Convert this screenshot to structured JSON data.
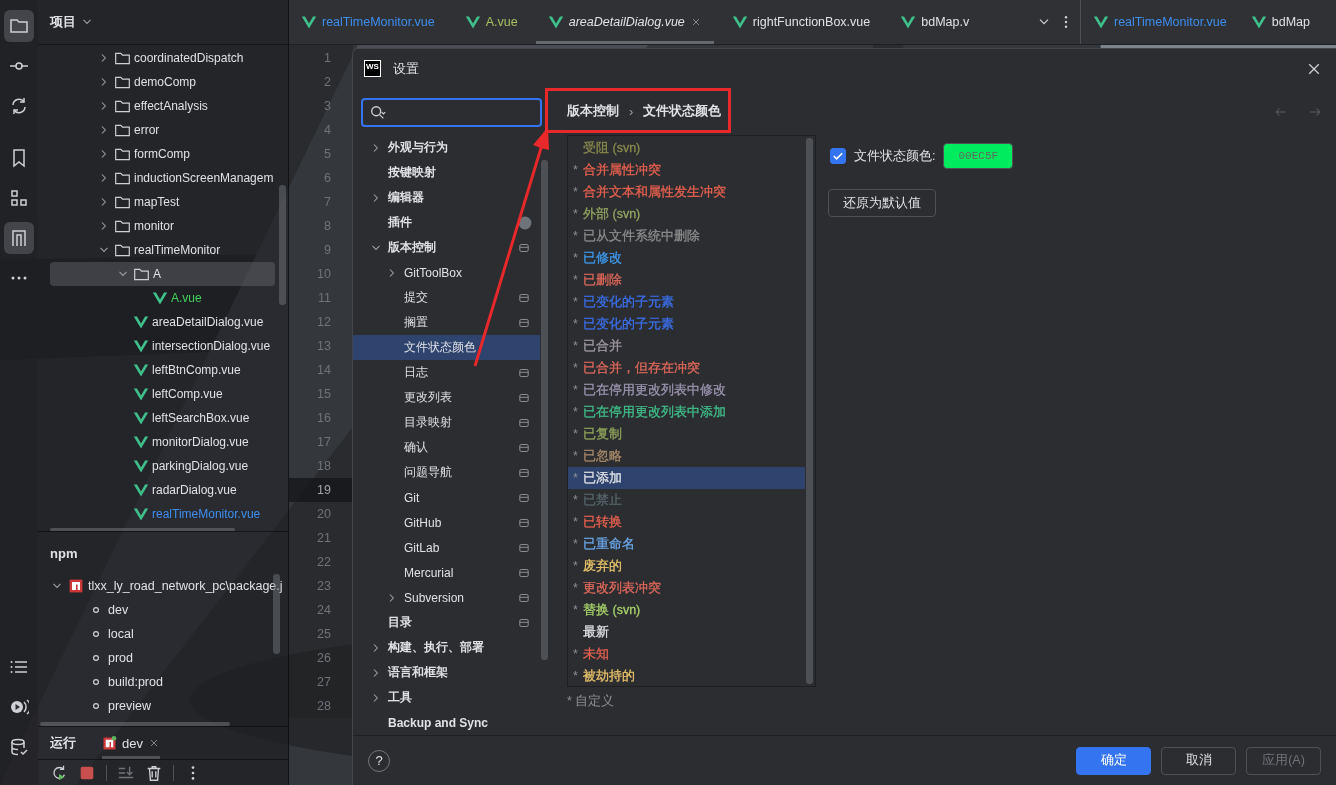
{
  "tool_strip": {
    "top": [
      {
        "kind": "folder",
        "selected": true
      },
      {
        "kind": "commit",
        "selected": false
      },
      {
        "kind": "sync",
        "selected": false
      },
      {
        "kind": "bookmark",
        "selected": false
      },
      {
        "kind": "blocks",
        "selected": false
      },
      {
        "kind": "pipe",
        "selected": true
      },
      {
        "kind": "more",
        "selected": false
      }
    ],
    "bottom": [
      {
        "kind": "list",
        "selected": false
      },
      {
        "kind": "play",
        "selected": false
      },
      {
        "kind": "database",
        "selected": false
      }
    ]
  },
  "project": {
    "title": "项目",
    "tree": [
      {
        "label": "coordinatedDispatch",
        "kind": "folder",
        "expanded": false,
        "selected": false,
        "color": "#dfe1e5"
      },
      {
        "label": "demoComp",
        "kind": "folder",
        "expanded": false,
        "selected": false,
        "color": "#dfe1e5"
      },
      {
        "label": "effectAnalysis",
        "kind": "folder",
        "expanded": false,
        "selected": false,
        "color": "#dfe1e5"
      },
      {
        "label": "error",
        "kind": "folder",
        "expanded": false,
        "selected": false,
        "color": "#dfe1e5"
      },
      {
        "label": "formComp",
        "kind": "folder",
        "expanded": false,
        "selected": false,
        "color": "#dfe1e5"
      },
      {
        "label": "inductionScreenManagem",
        "kind": "folder",
        "expanded": false,
        "selected": false,
        "color": "#dfe1e5"
      },
      {
        "label": "mapTest",
        "kind": "folder",
        "expanded": false,
        "selected": false,
        "color": "#dfe1e5"
      },
      {
        "label": "monitor",
        "kind": "folder",
        "expanded": false,
        "selected": false,
        "color": "#dfe1e5"
      },
      {
        "label": "realTimeMonitor",
        "kind": "folder",
        "expanded": true,
        "selected": false,
        "color": "#dfe1e5",
        "children": [
          {
            "label": "A",
            "kind": "folder",
            "expanded": true,
            "selected": true,
            "color": "#dfe1e5",
            "children": [
              {
                "label": "A.vue",
                "kind": "vue",
                "selected": false,
                "color": "#3fd15a"
              }
            ]
          },
          {
            "label": "areaDetailDialog.vue",
            "kind": "vue",
            "selected": false,
            "color": "#dfe1e5"
          },
          {
            "label": "intersectionDialog.vue",
            "kind": "vue",
            "selected": false,
            "color": "#dfe1e5"
          },
          {
            "label": "leftBtnComp.vue",
            "kind": "vue",
            "selected": false,
            "color": "#dfe1e5"
          },
          {
            "label": "leftComp.vue",
            "kind": "vue",
            "selected": false,
            "color": "#dfe1e5"
          },
          {
            "label": "leftSearchBox.vue",
            "kind": "vue",
            "selected": false,
            "color": "#dfe1e5"
          },
          {
            "label": "monitorDialog.vue",
            "kind": "vue",
            "selected": false,
            "color": "#dfe1e5"
          },
          {
            "label": "parkingDialog.vue",
            "kind": "vue",
            "selected": false,
            "color": "#dfe1e5"
          },
          {
            "label": "radarDialog.vue",
            "kind": "vue",
            "selected": false,
            "color": "#dfe1e5"
          },
          {
            "label": "realTimeMonitor.vue",
            "kind": "vue",
            "selected": false,
            "color": "#3d8ef0"
          }
        ]
      }
    ]
  },
  "npm": {
    "title": "npm",
    "package": {
      "label": "tlxx_ly_road_network_pc\\package.j",
      "expanded": true
    },
    "scripts": [
      "dev",
      "local",
      "prod",
      "build:prod",
      "preview"
    ]
  },
  "run": {
    "title": "运行",
    "tabs": [
      {
        "label": "dev",
        "selected": true
      }
    ]
  },
  "editor": {
    "panes": [
      {
        "tabs": [
          {
            "label": "realTimeMonitor.vue",
            "color": "#3d8ef0",
            "selected": false,
            "preview": false
          },
          {
            "label": "A.vue",
            "color": "#a8c060",
            "selected": false,
            "preview": false
          },
          {
            "label": "areaDetailDialog.vue",
            "color": "#dfe1e5",
            "selected": true,
            "preview": true
          },
          {
            "label": "rightFunctionBox.vue",
            "color": "#dfe1e5",
            "selected": false,
            "preview": false
          },
          {
            "label": "bdMap.v",
            "color": "#dfe1e5",
            "selected": false,
            "preview": false
          }
        ]
      },
      {
        "tabs": [
          {
            "label": "realTimeMonitor.vue",
            "color": "#3d8ef0",
            "selected": false,
            "preview": false
          },
          {
            "label": "bdMap",
            "color": "#dfe1e5",
            "selected": false,
            "preview": false
          }
        ]
      }
    ],
    "lines": [
      {
        "number": "1",
        "current": false
      },
      {
        "number": "2",
        "current": false
      },
      {
        "number": "3",
        "current": false
      },
      {
        "number": "4",
        "current": false
      },
      {
        "number": "5",
        "current": false
      },
      {
        "number": "6",
        "current": false
      },
      {
        "number": "7",
        "current": false
      },
      {
        "number": "8",
        "current": false
      },
      {
        "number": "9",
        "current": false
      },
      {
        "number": "10",
        "current": false
      },
      {
        "number": "11",
        "current": false
      },
      {
        "number": "12",
        "current": false
      },
      {
        "number": "13",
        "current": false
      },
      {
        "number": "14",
        "current": false
      },
      {
        "number": "15",
        "current": false
      },
      {
        "number": "16",
        "current": false
      },
      {
        "number": "17",
        "current": false
      },
      {
        "number": "18",
        "current": false
      },
      {
        "number": "19",
        "current": true
      },
      {
        "number": "20",
        "current": false
      },
      {
        "number": "21",
        "current": false
      },
      {
        "number": "22",
        "current": false
      },
      {
        "number": "23",
        "current": false
      },
      {
        "number": "24",
        "current": false
      },
      {
        "number": "25",
        "current": false
      },
      {
        "number": "26",
        "current": false
      },
      {
        "number": "27",
        "current": false
      },
      {
        "number": "28",
        "current": false
      }
    ]
  },
  "dialog": {
    "logo": "WS",
    "title": "设置",
    "nav": [
      {
        "label": "外观与行为",
        "expanded": false,
        "selected": false,
        "scoped": false
      },
      {
        "label": "按键映射",
        "selected": false,
        "scoped": false
      },
      {
        "label": "编辑器",
        "expanded": false,
        "selected": false,
        "scoped": false
      },
      {
        "label": "插件",
        "selected": false,
        "scoped": false,
        "badge": true
      },
      {
        "label": "版本控制",
        "expanded": true,
        "selected": false,
        "scoped": true,
        "children": [
          {
            "label": "GitToolBox",
            "expanded": false,
            "selected": false,
            "scoped": false
          },
          {
            "label": "提交",
            "selected": false,
            "scoped": true
          },
          {
            "label": "搁置",
            "selected": false,
            "scoped": true
          },
          {
            "label": "文件状态颜色",
            "selected": true,
            "scoped": false
          },
          {
            "label": "日志",
            "selected": false,
            "scoped": true
          },
          {
            "label": "更改列表",
            "selected": false,
            "scoped": true
          },
          {
            "label": "目录映射",
            "selected": false,
            "scoped": true
          },
          {
            "label": "确认",
            "selected": false,
            "scoped": true
          },
          {
            "label": "问题导航",
            "selected": false,
            "scoped": true
          },
          {
            "label": "Git",
            "selected": false,
            "scoped": true
          },
          {
            "label": "GitHub",
            "selected": false,
            "scoped": true
          },
          {
            "label": "GitLab",
            "selected": false,
            "scoped": true
          },
          {
            "label": "Mercurial",
            "selected": false,
            "scoped": true
          },
          {
            "label": "Subversion",
            "expanded": false,
            "selected": false,
            "scoped": true
          }
        ]
      },
      {
        "label": "目录",
        "selected": false,
        "scoped": true
      },
      {
        "label": "构建、执行、部署",
        "expanded": false,
        "selected": false,
        "scoped": false
      },
      {
        "label": "语言和框架",
        "expanded": false,
        "selected": false,
        "scoped": false
      },
      {
        "label": "工具",
        "expanded": false,
        "selected": false,
        "scoped": false
      },
      {
        "label": "Backup and Sync",
        "selected": false,
        "scoped": false
      }
    ],
    "breadcrumb": {
      "items": [
        "版本控制",
        "文件状态颜色"
      ],
      "separator": "›"
    },
    "statuses": [
      {
        "label": "受阻 (svn)",
        "color": "#8a8a4e",
        "selected": false
      },
      {
        "mark": "*",
        "label": "合并属性冲突",
        "color": "#e8604f",
        "selected": false
      },
      {
        "mark": "*",
        "label": "合并文本和属性发生冲突",
        "color": "#e8604f",
        "selected": false
      },
      {
        "mark": "*",
        "label": "外部 (svn)",
        "color": "#93a460",
        "selected": false
      },
      {
        "mark": "*",
        "label": "已从文件系统中删除",
        "color": "#8c8c8c",
        "selected": false
      },
      {
        "mark": "*",
        "label": "已修改",
        "color": "#3d9bf0",
        "selected": false
      },
      {
        "mark": "*",
        "label": "已删除",
        "color": "#e0685a",
        "selected": false
      },
      {
        "mark": "*",
        "label": "已变化的子元素",
        "color": "#3b6fed",
        "selected": false
      },
      {
        "mark": "*",
        "label": "已变化的子元素",
        "color": "#3b6fed",
        "selected": false
      },
      {
        "mark": "*",
        "label": "已合并",
        "color": "#a39aa8",
        "selected": false
      },
      {
        "mark": "*",
        "label": "已合并，但存在冲突",
        "color": "#e0685a",
        "selected": false
      },
      {
        "mark": "*",
        "label": "已在停用更改列表中修改",
        "color": "#9b93b0",
        "selected": false
      },
      {
        "mark": "*",
        "label": "已在停用更改列表中添加",
        "color": "#3fbf8a",
        "selected": false
      },
      {
        "mark": "*",
        "label": "已复制",
        "color": "#8fa35a",
        "selected": false
      },
      {
        "mark": "*",
        "label": "已忽略",
        "color": "#a98a6a",
        "selected": false
      },
      {
        "mark": "*",
        "label": "已添加",
        "color": "#dfe1e5",
        "selected": true
      },
      {
        "mark": "*",
        "label": "已禁止",
        "color": "#55656a",
        "selected": false
      },
      {
        "mark": "*",
        "label": "已转换",
        "color": "#e8604f",
        "selected": false
      },
      {
        "mark": "*",
        "label": "已重命名",
        "color": "#6aa7ec",
        "selected": false
      },
      {
        "mark": "*",
        "label": "废弃的",
        "color": "#e8c26a",
        "selected": false
      },
      {
        "mark": "*",
        "label": "更改列表冲突",
        "color": "#e0685a",
        "selected": false
      },
      {
        "mark": "*",
        "label": "替换 (svn)",
        "color": "#a6d36a",
        "selected": false
      },
      {
        "label": "最新",
        "color": "#dfe1e5",
        "selected": false
      },
      {
        "mark": "*",
        "label": "未知",
        "color": "#e8604f",
        "selected": false
      },
      {
        "mark": "*",
        "label": "被劫持的",
        "color": "#e8c26a",
        "selected": false
      }
    ],
    "legend": "* 自定义",
    "color_option": {
      "checked": true,
      "label": "文件状态颜色:",
      "value": "00EC5F",
      "color": "#00ec5f"
    },
    "reset_button": "还原为默认值",
    "help": "?",
    "buttons": [
      {
        "label": "确定",
        "kind": "primary",
        "disabled": false
      },
      {
        "label": "取消",
        "kind": "normal",
        "disabled": false
      },
      {
        "label": "应用(A)",
        "kind": "normal",
        "disabled": true
      }
    ]
  }
}
